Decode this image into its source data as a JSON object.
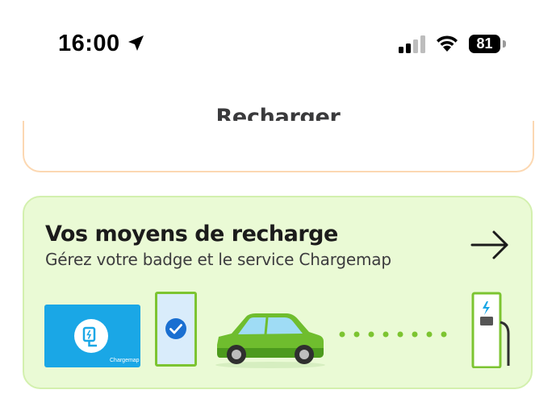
{
  "status_bar": {
    "time": "16:00",
    "battery": "81"
  },
  "header": {
    "title": "Recharger"
  },
  "card": {
    "title": "Vos moyens de recharge",
    "subtitle": "Gérez votre badge et le service Chargemap",
    "badge_brand": "Chargemap"
  },
  "colors": {
    "card_background": "#eafad5",
    "card_border": "#d3f0ae",
    "accent_green": "#7cc431",
    "badge_blue": "#1aa7e6",
    "orange_border": "#fcd8b2"
  },
  "icons": [
    "location-arrow-icon",
    "cellular-signal-icon",
    "wifi-icon",
    "battery-icon",
    "arrow-right-icon",
    "plug-icon",
    "check-icon",
    "car-icon",
    "charging-station-icon",
    "lightning-icon"
  ]
}
